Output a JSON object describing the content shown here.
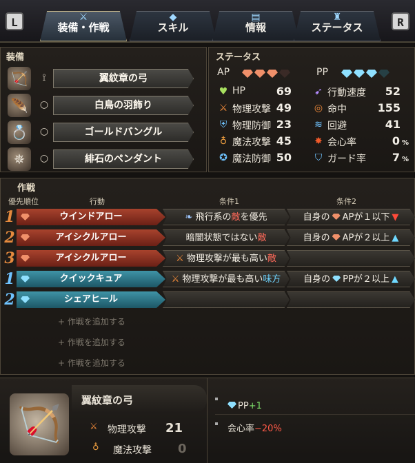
{
  "topbar": {
    "left_button": "L",
    "right_button": "R",
    "tabs": [
      {
        "label": "装備・作戦",
        "icon": "sword-icon"
      },
      {
        "label": "スキル",
        "icon": "gem-icon"
      },
      {
        "label": "情報",
        "icon": "scroll-icon"
      },
      {
        "label": "ステータス",
        "icon": "figure-icon"
      }
    ],
    "active_tab": 0
  },
  "equipment": {
    "title": "装備",
    "items": [
      {
        "name": "翼紋章の弓",
        "slot_icon": "bow-slot-icon",
        "item_icon": "bow-icon"
      },
      {
        "name": "白鳥の羽飾り",
        "slot_icon": "ring-slot-icon",
        "item_icon": "feather-icon"
      },
      {
        "name": "ゴールドバングル",
        "slot_icon": "ring-slot-icon",
        "item_icon": "bangle-icon"
      },
      {
        "name": "緋石のペンダント",
        "slot_icon": "ring-slot-icon",
        "item_icon": "pendant-icon"
      }
    ]
  },
  "status": {
    "title": "ステータス",
    "ap_label": "AP",
    "pp_label": "PP",
    "ap_gems": 3,
    "ap_max": 4,
    "pp_gems": 3,
    "pp_max": 4,
    "left": [
      {
        "label": "HP",
        "value": "69",
        "icon": "heart-icon",
        "color": "#a8e060"
      },
      {
        "label": "物理攻撃",
        "value": "49",
        "icon": "sword-icon",
        "color": "#f08a3a"
      },
      {
        "label": "物理防御",
        "value": "23",
        "icon": "armor-icon",
        "color": "#6fc3ff"
      },
      {
        "label": "魔法攻撃",
        "value": "45",
        "icon": "wand-icon",
        "color": "#f0a040"
      },
      {
        "label": "魔法防御",
        "value": "50",
        "icon": "magic-shield-icon",
        "color": "#6fc3ff"
      }
    ],
    "right": [
      {
        "label": "行動速度",
        "value": "52",
        "unit": "",
        "icon": "speed-icon",
        "color": "#b48cff"
      },
      {
        "label": "命中",
        "value": "155",
        "unit": "",
        "icon": "target-icon",
        "color": "#f08a3a"
      },
      {
        "label": "回避",
        "value": "41",
        "unit": "",
        "icon": "evade-icon",
        "color": "#6fc3ff"
      },
      {
        "label": "会心率",
        "value": "0",
        "unit": "%",
        "icon": "critical-icon",
        "color": "#f05a2a"
      },
      {
        "label": "ガード率",
        "value": "7",
        "unit": "%",
        "icon": "shield-icon",
        "color": "#6fc3ff"
      }
    ]
  },
  "tactics": {
    "title": "作戦",
    "headers": {
      "priority": "優先順位",
      "action": "行動",
      "cond1": "条件1",
      "cond2": "条件2"
    },
    "rows": [
      {
        "num": "1",
        "type": "red",
        "action": "ウインドアロー",
        "gem": "ap",
        "cond1": {
          "pre": "飛行系の",
          "hi": "敵",
          "post": "を優先",
          "hi_color": "red",
          "icon": "wing-icon"
        },
        "cond2": {
          "pre": "自身の",
          "mid": "APが１以下",
          "gem": "ap",
          "arrow": "▼"
        }
      },
      {
        "num": "2",
        "type": "red",
        "action": "アイシクルアロー",
        "gem": "ap2",
        "cond1": {
          "pre": "暗闇状態ではない",
          "hi": "敵",
          "post": "",
          "hi_color": "red",
          "icon": ""
        },
        "cond2": {
          "pre": "自身の",
          "mid": "APが２以上",
          "gem": "ap",
          "arrow": "▲"
        }
      },
      {
        "num": "3",
        "type": "red",
        "action": "アイシクルアロー",
        "gem": "ap2",
        "cond1": {
          "pre": "物理攻撃が最も高い",
          "hi": "敵",
          "post": "",
          "hi_color": "red",
          "icon": "sword-icon"
        },
        "cond2": null
      },
      {
        "num": "1",
        "type": "blue",
        "action": "クイックキュア",
        "gem": "pp",
        "cond1": {
          "pre": "物理攻撃が最も高い",
          "hi": "味方",
          "post": "",
          "hi_color": "blue",
          "icon": "sword-icon"
        },
        "cond2": {
          "pre": "自身の",
          "mid": "PPが２以上",
          "gem": "pp",
          "arrow": "▲"
        }
      },
      {
        "num": "2",
        "type": "blue",
        "action": "シェアヒール",
        "gem": "pp",
        "cond1": null,
        "cond2": null
      }
    ],
    "add_label": "+ 作戦を追加する",
    "add_slots": 3
  },
  "detail": {
    "name": "翼紋章の弓",
    "stats": [
      {
        "label": "物理攻撃",
        "value": "21",
        "icon": "sword-icon",
        "dim": false
      },
      {
        "label": "魔法攻撃",
        "value": "0",
        "icon": "wand-icon",
        "dim": true
      }
    ],
    "effects": [
      {
        "label": "PP",
        "change": "+1",
        "color": "#7ee06a",
        "gem": true
      },
      {
        "label": "会心率",
        "change": "−20%",
        "color": "#ff5a48",
        "gem": false
      }
    ]
  },
  "colors": {
    "ap_gem": "#f0906a",
    "pp_gem": "#8fe0ff",
    "gem_empty": "#3a2a26",
    "pp_empty": "#264045"
  }
}
